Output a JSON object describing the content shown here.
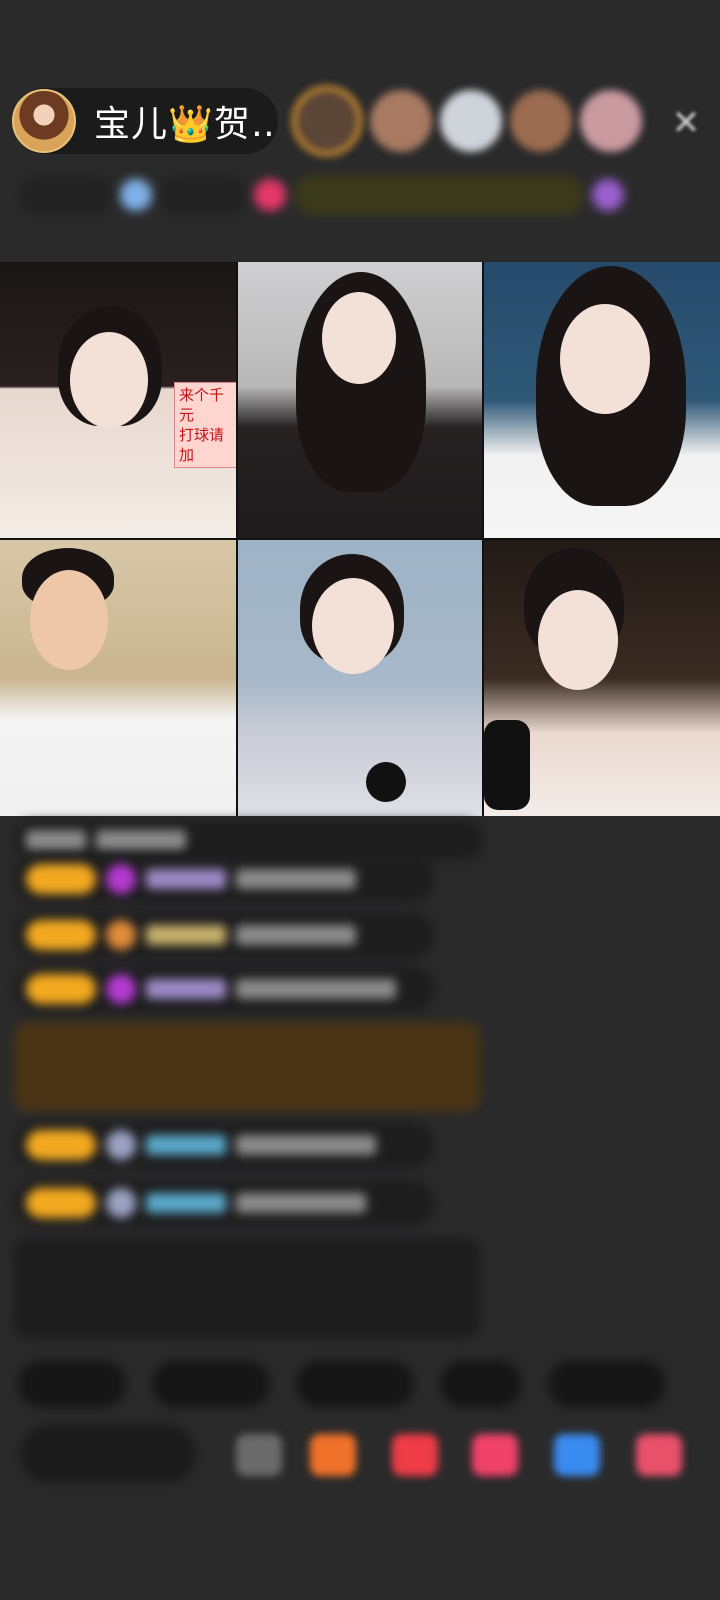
{
  "header": {
    "anchor_name": "宝儿👑贺…",
    "close_icon": "close-icon"
  },
  "grid": {
    "tiles": [
      {
        "name": "co-host-1",
        "sign_text": "来个千元\n打球请加"
      },
      {
        "name": "co-host-2"
      },
      {
        "name": "co-host-3"
      },
      {
        "name": "co-host-4"
      },
      {
        "name": "co-host-5"
      },
      {
        "name": "co-host-6"
      }
    ]
  }
}
